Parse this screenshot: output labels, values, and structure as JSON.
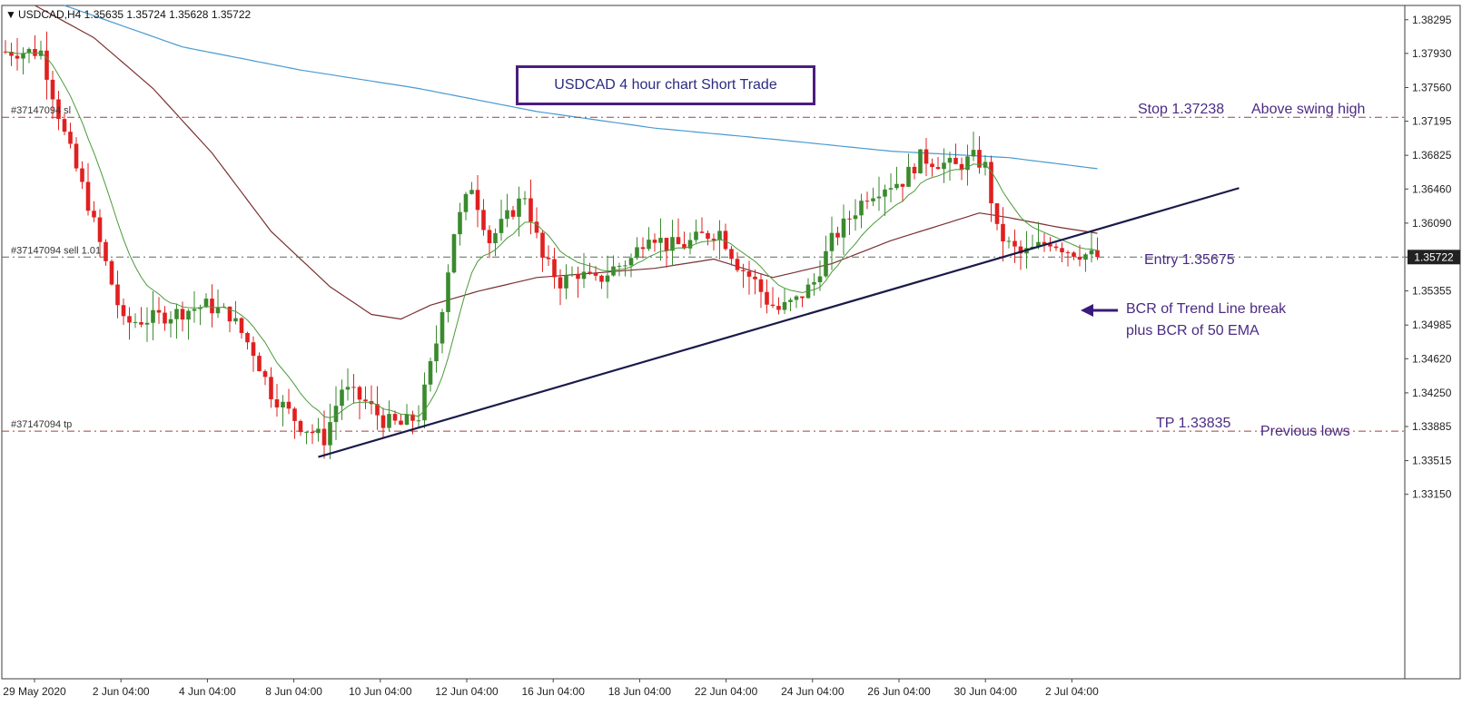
{
  "header": {
    "arrow": "▼",
    "symbol_info": "USDCAD,H4  1.35635 1.35724 1.35628 1.35722"
  },
  "title_box": "USDCAD 4 hour chart Short Trade",
  "colors": {
    "bull": "#3a8a2e",
    "bear": "#e02020",
    "ema_fast": "#4c9a3a",
    "ema_50": "#7a3030",
    "ema_200": "#4a9ad0",
    "level_line": "#a04040",
    "entry_line": "#5a6a5a",
    "trendline": "#1a1a4a",
    "annotation": "#4b2b83",
    "price_tag_bg": "#222222"
  },
  "price_tag": "1.35722",
  "order_labels": {
    "sl": "#37147094 sl",
    "entry": "#37147094 sell 1.01",
    "tp": "#37147094 tp"
  },
  "annotations": {
    "stop": "Stop 1.37238",
    "stop_note": "Above swing high",
    "bcr_line1": "BCR of Trend Line break",
    "bcr_line2": "plus BCR of 50 EMA",
    "entry": "Entry 1.35675",
    "tp": "TP 1.33835",
    "tp_note": "Previous lows"
  },
  "chart_data": {
    "type": "candlestick",
    "title": "USDCAD 4 hour chart Short Trade",
    "symbol": "USDCAD",
    "timeframe": "H4",
    "ylim": [
      1.3115,
      1.3845
    ],
    "y_ticks": [
      "1.38295",
      "1.37930",
      "1.37560",
      "1.37195",
      "1.36825",
      "1.36460",
      "1.36090",
      "1.35722",
      "1.35355",
      "1.34985",
      "1.34620",
      "1.34250",
      "1.33885",
      "1.33515",
      "1.33150"
    ],
    "x_ticks": [
      "29 May 2020",
      "2 Jun 04:00",
      "4 Jun 04:00",
      "8 Jun 04:00",
      "10 Jun 04:00",
      "12 Jun 04:00",
      "16 Jun 04:00",
      "18 Jun 04:00",
      "22 Jun 04:00",
      "24 Jun 04:00",
      "26 Jun 04:00",
      "30 Jun 04:00",
      "2 Jul 04:00"
    ],
    "levels": {
      "stop": 1.37238,
      "entry": 1.35675,
      "tp": 1.33835,
      "current": 1.35722
    },
    "waypoints": [
      {
        "i": 0,
        "p": 1.3795
      },
      {
        "i": 6,
        "p": 1.3795
      },
      {
        "i": 10,
        "p": 1.3705
      },
      {
        "i": 14,
        "p": 1.363
      },
      {
        "i": 20,
        "p": 1.35
      },
      {
        "i": 24,
        "p": 1.3505
      },
      {
        "i": 28,
        "p": 1.351
      },
      {
        "i": 34,
        "p": 1.352
      },
      {
        "i": 38,
        "p": 1.351
      },
      {
        "i": 42,
        "p": 1.347
      },
      {
        "i": 45,
        "p": 1.3425
      },
      {
        "i": 50,
        "p": 1.339
      },
      {
        "i": 54,
        "p": 1.3375
      },
      {
        "i": 57,
        "p": 1.343
      },
      {
        "i": 61,
        "p": 1.3415
      },
      {
        "i": 64,
        "p": 1.3395
      },
      {
        "i": 67,
        "p": 1.339
      },
      {
        "i": 70,
        "p": 1.34
      },
      {
        "i": 73,
        "p": 1.348
      },
      {
        "i": 76,
        "p": 1.36
      },
      {
        "i": 79,
        "p": 1.365
      },
      {
        "i": 82,
        "p": 1.359
      },
      {
        "i": 85,
        "p": 1.3615
      },
      {
        "i": 88,
        "p": 1.364
      },
      {
        "i": 91,
        "p": 1.357
      },
      {
        "i": 94,
        "p": 1.3545
      },
      {
        "i": 97,
        "p": 1.3555
      },
      {
        "i": 100,
        "p": 1.3545
      },
      {
        "i": 103,
        "p": 1.356
      },
      {
        "i": 106,
        "p": 1.357
      },
      {
        "i": 109,
        "p": 1.36
      },
      {
        "i": 112,
        "p": 1.3585
      },
      {
        "i": 115,
        "p": 1.3585
      },
      {
        "i": 118,
        "p": 1.3595
      },
      {
        "i": 121,
        "p": 1.36
      },
      {
        "i": 124,
        "p": 1.3565
      },
      {
        "i": 127,
        "p": 1.3545
      },
      {
        "i": 129,
        "p": 1.3525
      },
      {
        "i": 131,
        "p": 1.3515
      },
      {
        "i": 134,
        "p": 1.3525
      },
      {
        "i": 137,
        "p": 1.3545
      },
      {
        "i": 140,
        "p": 1.359
      },
      {
        "i": 143,
        "p": 1.3615
      },
      {
        "i": 146,
        "p": 1.364
      },
      {
        "i": 149,
        "p": 1.365
      },
      {
        "i": 152,
        "p": 1.3655
      },
      {
        "i": 155,
        "p": 1.368
      },
      {
        "i": 158,
        "p": 1.3675
      },
      {
        "i": 161,
        "p": 1.367
      },
      {
        "i": 164,
        "p": 1.368
      },
      {
        "i": 166,
        "p": 1.367
      },
      {
        "i": 168,
        "p": 1.36
      },
      {
        "i": 170,
        "p": 1.3585
      },
      {
        "i": 172,
        "p": 1.3575
      },
      {
        "i": 174,
        "p": 1.358
      },
      {
        "i": 177,
        "p": 1.359
      },
      {
        "i": 180,
        "p": 1.358
      },
      {
        "i": 183,
        "p": 1.3575
      },
      {
        "i": 185,
        "p": 1.3572
      }
    ],
    "ema_200": [
      {
        "i": 10,
        "p": 1.3845
      },
      {
        "i": 30,
        "p": 1.38
      },
      {
        "i": 50,
        "p": 1.3775
      },
      {
        "i": 70,
        "p": 1.3755
      },
      {
        "i": 90,
        "p": 1.373
      },
      {
        "i": 110,
        "p": 1.3712
      },
      {
        "i": 130,
        "p": 1.37
      },
      {
        "i": 150,
        "p": 1.3687
      },
      {
        "i": 170,
        "p": 1.368
      },
      {
        "i": 185,
        "p": 1.3668
      }
    ],
    "ema_50": [
      {
        "i": 5,
        "p": 1.3845
      },
      {
        "i": 15,
        "p": 1.381
      },
      {
        "i": 25,
        "p": 1.3755
      },
      {
        "i": 35,
        "p": 1.3685
      },
      {
        "i": 45,
        "p": 1.36
      },
      {
        "i": 55,
        "p": 1.354
      },
      {
        "i": 62,
        "p": 1.351
      },
      {
        "i": 67,
        "p": 1.3505
      },
      {
        "i": 72,
        "p": 1.352
      },
      {
        "i": 80,
        "p": 1.3535
      },
      {
        "i": 90,
        "p": 1.355
      },
      {
        "i": 100,
        "p": 1.3555
      },
      {
        "i": 110,
        "p": 1.356
      },
      {
        "i": 120,
        "p": 1.357
      },
      {
        "i": 130,
        "p": 1.355
      },
      {
        "i": 140,
        "p": 1.3565
      },
      {
        "i": 150,
        "p": 1.359
      },
      {
        "i": 160,
        "p": 1.361
      },
      {
        "i": 165,
        "p": 1.362
      },
      {
        "i": 170,
        "p": 1.3615
      },
      {
        "i": 178,
        "p": 1.3605
      },
      {
        "i": 185,
        "p": 1.3598
      }
    ],
    "trendline": [
      {
        "i": 53,
        "p": 1.33555
      },
      {
        "i": 209,
        "p": 1.3647
      }
    ]
  }
}
